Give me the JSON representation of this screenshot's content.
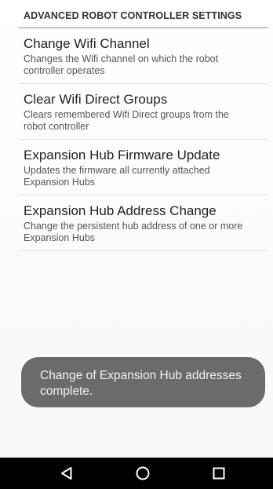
{
  "section": {
    "title": "ADVANCED ROBOT CONTROLLER SETTINGS"
  },
  "preferences": [
    {
      "title": "Change Wifi Channel",
      "summary": "Changes the Wifi channel on which the robot controller operates"
    },
    {
      "title": "Clear Wifi Direct Groups",
      "summary": "Clears remembered Wifi Direct groups from the robot controller"
    },
    {
      "title": "Expansion Hub Firmware Update",
      "summary": "Updates the firmware all currently attached Expansion Hubs"
    },
    {
      "title": "Expansion Hub Address Change",
      "summary": "Change the persistent hub address of one or more Expansion Hubs"
    }
  ],
  "toast": {
    "message": "Change of Expansion Hub addresses complete."
  },
  "nav": {
    "back_icon": "back-triangle-icon",
    "home_icon": "home-circle-icon",
    "recents_icon": "recents-square-icon"
  },
  "colors": {
    "toast_bg": "#6b6b6b",
    "nav_bg": "#000000",
    "divider": "#8f8f8f"
  }
}
